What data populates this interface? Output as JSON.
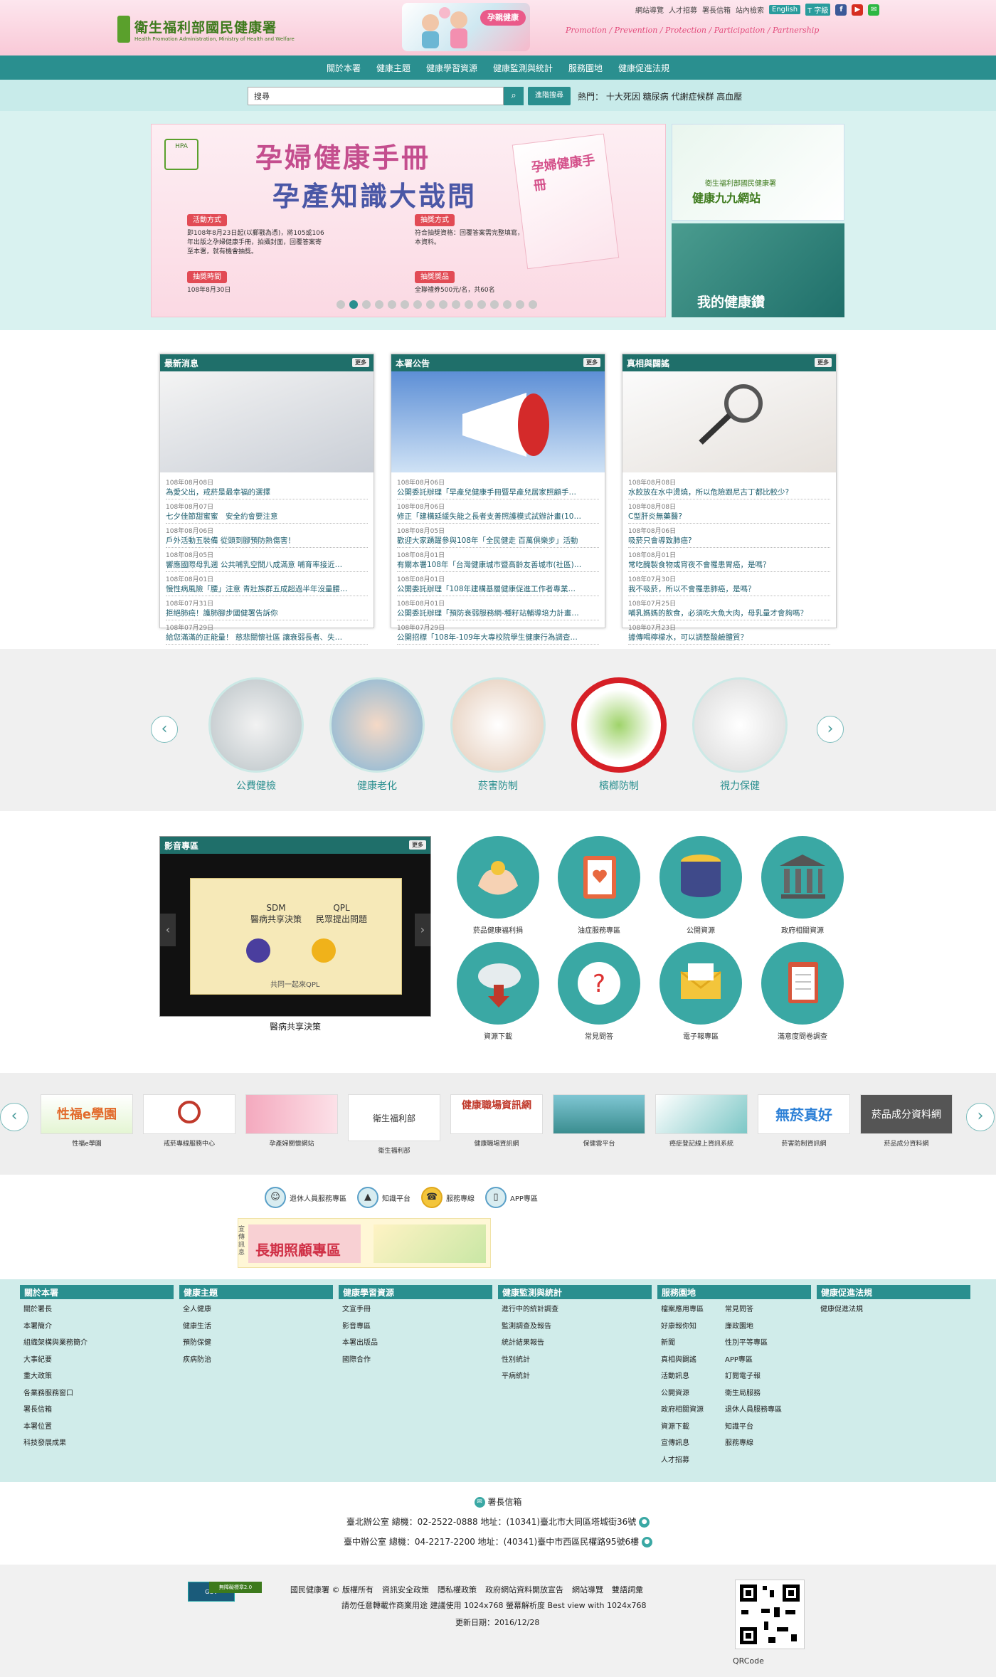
{
  "header": {
    "logo_name": "衛生福利部國民健康署",
    "logo_sub": "Health Promotion Administration, Ministry of Health and Welfare",
    "hero_badge": "孕親健康",
    "slogan": "Promotion / Prevention / Protection / Participation / Partnership",
    "top_links": [
      "網站導覽",
      "人才招募",
      "署長信箱",
      "站內檢索"
    ],
    "english": "English",
    "font_size": "T 字級"
  },
  "nav": [
    "關於本署",
    "健康主題",
    "健康學習資源",
    "健康監測與統計",
    "服務園地",
    "健康促進法規"
  ],
  "search": {
    "placeholder": "搜尋",
    "value": "搜尋",
    "advanced": "進階搜尋",
    "hot_label": "熱門：",
    "hot_terms": "十大死因 糖尿病 代謝症候群 高血壓"
  },
  "banner": {
    "title1": "孕婦健康手冊",
    "title2": "孕產知識大哉問",
    "box_activity_head": "活動方式",
    "box_activity_text": "即108年8月23日起(以郵戳為憑)，將105或106年出版之孕婦健康手冊，拍攝封面，回覆答案寄至本署，就有機會抽獎。",
    "box_lottery_head": "抽獎方式",
    "box_lottery_text": "符合抽獎資格：回覆答案需完整填寫，並確認基本資料。",
    "box_time_head": "抽獎時間",
    "box_time_text": "108年8月30日",
    "box_prize_head": "抽獎獎品",
    "box_prize_text": "全聯禮券500元/名，共60名",
    "book_text": "孕婦健康手冊",
    "side1_title": "健康九九網站",
    "side1_sub": "衛生福利部國民健康署",
    "side2_title": "我的健康鑽"
  },
  "news_cols": [
    {
      "title": "最新消息",
      "more": "更多",
      "items": [
        {
          "date": "108年08月08日",
          "text": "為愛父出，戒菸是最幸福的選擇"
        },
        {
          "date": "108年08月07日",
          "text": "七夕佳節甜蜜蜜　安全約會要注意"
        },
        {
          "date": "108年08月06日",
          "text": "戶外活動五裝備 從頭到腳預防熱傷害！"
        },
        {
          "date": "108年08月05日",
          "text": "響應國際母乳週 公共哺乳空間八成滿意 哺育率接近…"
        },
        {
          "date": "108年08月01日",
          "text": "慢性病風險「腰」注意 青壯族群五成超過半年沒量腰…"
        },
        {
          "date": "108年07月31日",
          "text": "拒絕肺癌！護肺腳步國健署告訴你"
        },
        {
          "date": "108年07月29日",
          "text": "給您滿滿的正能量！ 慈悲關懷社區 讓衰弱長者、失…"
        }
      ]
    },
    {
      "title": "本署公告",
      "more": "更多",
      "items": [
        {
          "date": "108年08月06日",
          "text": "公開委託辦理「早產兒健康手冊暨早產兒居家照顧手…"
        },
        {
          "date": "108年08月06日",
          "text": "修正「建構延緩失能之長者支善照護模式試辦計畫(10…"
        },
        {
          "date": "108年08月05日",
          "text": "歡迎大家踴躍參與108年「全民健走 百萬俱樂步」活動"
        },
        {
          "date": "108年08月01日",
          "text": "有關本署108年「台灣健康城市暨高齡友善城市(社區)…"
        },
        {
          "date": "108年08月01日",
          "text": "公開委託辦理「108年建構基層健康促進工作者專業…"
        },
        {
          "date": "108年08月01日",
          "text": "公開委託辦理「預防衰弱服務網-種籽站輔導培力計畫…"
        },
        {
          "date": "108年07月29日",
          "text": "公開招標「108年-109年大專校院學生健康行為調查…"
        }
      ]
    },
    {
      "title": "真相與闢謠",
      "more": "更多",
      "items": [
        {
          "date": "108年08月08日",
          "text": "水餃放在水中燙燒，所以危險跟尼古丁都比較少?"
        },
        {
          "date": "108年08月08日",
          "text": "C型肝炎無藥醫?"
        },
        {
          "date": "108年08月06日",
          "text": "吸菸只會導致肺癌?"
        },
        {
          "date": "108年08月01日",
          "text": "常吃醃製食物或宵夜不會罹患胃癌，是嗎？"
        },
        {
          "date": "108年07月30日",
          "text": "我不吸菸，所以不會罹患肺癌，是嗎？"
        },
        {
          "date": "108年07月25日",
          "text": "哺乳媽媽的飲食，必須吃大魚大肉，母乳量才會夠嗎？"
        },
        {
          "date": "108年07月23日",
          "text": "據傳喝檸檬水，可以調整酸鹼體質？"
        }
      ]
    }
  ],
  "topics": [
    "公費健檢",
    "健康老化",
    "菸害防制",
    "檳榔防制",
    "視力保健"
  ],
  "media": {
    "title": "影音專區",
    "more": "更多",
    "sdm": "SDM",
    "sdm_sub": "醫病共享決策",
    "qpl": "QPL",
    "qpl_sub": "民眾提出問題",
    "bottom": "共同一起來QPL",
    "caption": "醫病共享決策"
  },
  "icons": [
    "菸品健康福利捐",
    "油症服務專區",
    "公開資源",
    "政府相關資源",
    "資源下載",
    "常見問答",
    "電子報專區",
    "滿意度問卷調查"
  ],
  "partners": [
    {
      "label": "性福e學園",
      "logo": "性福e學園"
    },
    {
      "label": "戒菸專線服務中心",
      "logo": ""
    },
    {
      "label": "孕產婦關懷網站",
      "logo": ""
    },
    {
      "label": "衛生福利部",
      "logo": "衛生福利部"
    },
    {
      "label": "健康職場資訊網",
      "logo": "健康職場資訊網"
    },
    {
      "label": "保健雲平台",
      "logo": ""
    },
    {
      "label": "癌症登記線上資訊系統",
      "logo": ""
    },
    {
      "label": "菸害防制資訊網",
      "logo": "無菸真好"
    },
    {
      "label": "菸品成分資料網",
      "logo": "菸品成分資料網"
    }
  ],
  "quick_links": [
    "退休人員服務專區",
    "知識平台",
    "服務專線",
    "APP專區"
  ],
  "promo": {
    "a": "長期照顧專區",
    "a_side": "宣傳訊息"
  },
  "sitemap": [
    {
      "title": "關於本署",
      "items": [
        "關於署長",
        "本署簡介",
        "組織架構與業務簡介",
        "大事紀要",
        "重大政策",
        "各業務服務窗口",
        "署長信箱",
        "本署位置",
        "科技發展成果"
      ]
    },
    {
      "title": "健康主題",
      "items": [
        "全人健康",
        "健康生活",
        "預防保健",
        "疾病防治"
      ]
    },
    {
      "title": "健康學習資源",
      "items": [
        "文宣手冊",
        "影音專區",
        "本署出版品",
        "國際合作"
      ]
    },
    {
      "title": "健康監測與統計",
      "items": [
        "進行中的統計調查",
        "監測調查及報告",
        "統計結果報告",
        "性別統計",
        "平病統計"
      ]
    },
    {
      "title": "服務園地",
      "items": [
        "檔案應用專區",
        "好康報你知",
        "新聞",
        "真相與闢謠",
        "活動訊息",
        "公開資源",
        "政府相關資源",
        "資源下載",
        "宣傳訊息",
        "人才招募"
      ],
      "items2": [
        "常見問答",
        "廉政園地",
        "性別平等專區",
        "APP專區",
        "訂閱電子報",
        "衛生局服務",
        "退休人員服務專區",
        "知識平台",
        "服務專線"
      ]
    },
    {
      "title": "健康促進法規",
      "items": [
        "健康促進法規"
      ]
    }
  ],
  "contact": {
    "mailbox": "署長信箱",
    "taipei": "臺北辦公室 總機：02-2522-0888 地址：(10341)臺北市大同區塔城街36號",
    "taichung": "臺中辦公室 總機：04-2217-2200 地址：(40341)臺中市西區民權路95號6樓"
  },
  "footer": {
    "links": [
      "國民健康署 © 版權所有",
      "資訊安全政策",
      "隱私權政策",
      "政府網站資料開放宣告",
      "網站導覽",
      "雙語詞彙"
    ],
    "notice": "請勿任意轉載作商業用途 建議使用 1024x768 螢幕解析度 Best view with 1024x768",
    "updated": "更新日期：2016/12/28",
    "qr_label": "QRCode",
    "gov_badge": "GOV",
    "a11y_badge": "無障礙標章2.0"
  },
  "colors": {
    "teal": "#2a8f8f",
    "dark_teal": "#1f6f6a",
    "pink": "#e24b7b",
    "light_teal": "#d0ecea"
  }
}
